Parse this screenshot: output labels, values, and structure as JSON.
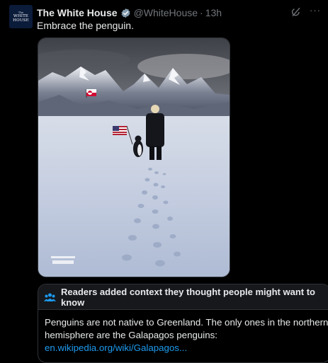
{
  "account": {
    "avatar_line1": "The",
    "avatar_line2": "WHITE",
    "avatar_line3": "HOUSE",
    "name": "The White House",
    "handle": "@WhiteHouse",
    "separator": "·",
    "time": "13h"
  },
  "tweet": {
    "text": "Embrace the penguin."
  },
  "media": {
    "icons": [
      "greenland-flag-icon",
      "us-flag-icon",
      "penguin-icon",
      "watermark-icon"
    ],
    "colors": {
      "sky": "#8d8f99",
      "snow": "#cdd5e4",
      "mountains": "#5b6273"
    }
  },
  "community_note": {
    "header": "Readers added context they thought people might want to know",
    "body_line1": "Penguins are not native to Greenland. The only ones in the northern",
    "body_line2": "hemisphere are the Galapagos penguins:",
    "link": "en.wikipedia.org/wiki/Galapagos..."
  },
  "colors": {
    "accent": "#1d9bf0",
    "muted": "#71767b",
    "background": "#000000"
  }
}
